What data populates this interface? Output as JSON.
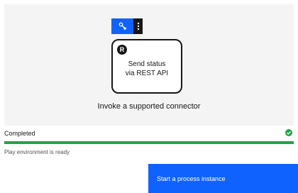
{
  "canvas": {
    "toolbar": {
      "primary_icon": "connector-settings-icon",
      "menu_icon": "overflow-menu-vertical-icon"
    },
    "task": {
      "marker": "R",
      "marker_icon": "rest-connector-icon",
      "label": "Send status via REST API"
    },
    "caption": "Invoke a supported connector"
  },
  "status": {
    "label": "Completed",
    "icon": "checkmark-filled-icon",
    "progress": 1.0,
    "helper": "Play environment is ready"
  },
  "actions": {
    "start_label": "Start a process instance"
  },
  "colors": {
    "primary": "#0f62fe",
    "success": "#24a148",
    "canvas_bg": "#f4f4f4",
    "text": "#161616"
  }
}
